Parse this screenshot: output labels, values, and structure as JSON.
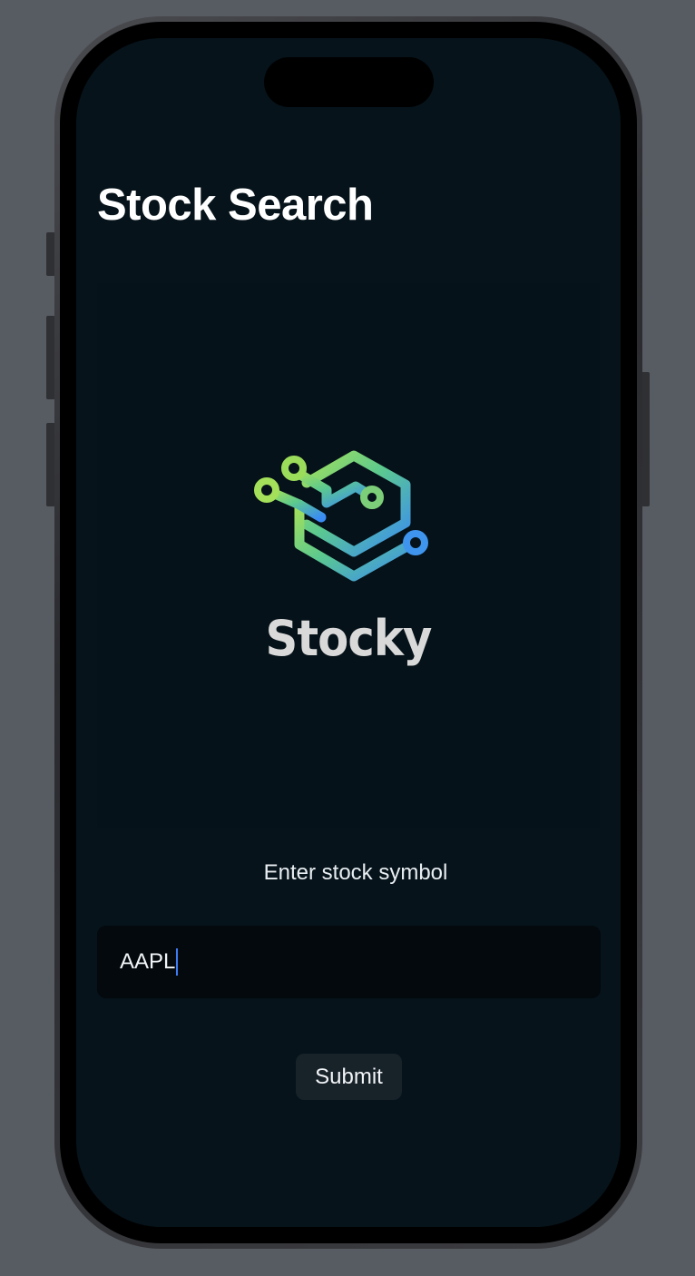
{
  "header": {
    "title": "Stock Search"
  },
  "logo": {
    "icon": "circuit-hexagon-logo-icon",
    "wordmark": "Stocky",
    "colors": {
      "gradient_start": "#9bdc5a",
      "gradient_end": "#3b8ef2",
      "wordmark": "#d9d9d9"
    }
  },
  "form": {
    "prompt": "Enter stock symbol",
    "symbol_value": "AAPL",
    "submit_label": "Submit"
  },
  "theme": {
    "background": "#06131a",
    "field_background": "#03090d",
    "button_background": "#172229",
    "caret_color": "#3d7cf5"
  }
}
